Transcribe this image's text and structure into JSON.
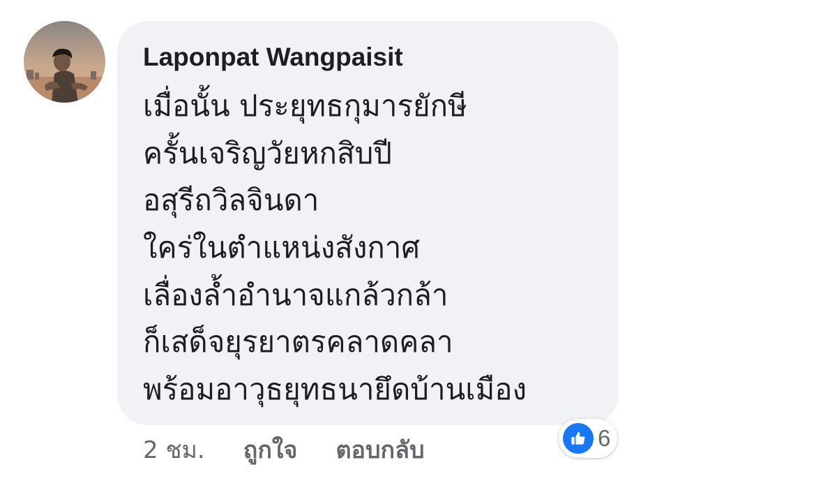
{
  "comment": {
    "author": "Laponpat Wangpaisit",
    "avatar_icon": "profile-photo-icon",
    "lines": [
      "เมื่อนั้น ประยุทธกุมารยักษี",
      "ครั้นเจริญวัยหกสิบปี",
      "อสุรีถวิลจินดา",
      "ใคร่ในตำแหน่งสังกาศ",
      "เลื่องล้ำอำนาจแกล้วกล้า",
      "ก็เสด็จยุรยาตรคลาดคลา",
      "พร้อมอาวุธยุทธนายึดบ้านเมือง"
    ],
    "bubble_color": "#f1f2f6"
  },
  "footer": {
    "time": "2 ชม.",
    "like_label": "ถูกใจ",
    "reply_label": "ตอบกลับ"
  },
  "reactions": {
    "icon": "thumbs-up-icon",
    "count": "6",
    "badge_color": "#1877f2"
  }
}
